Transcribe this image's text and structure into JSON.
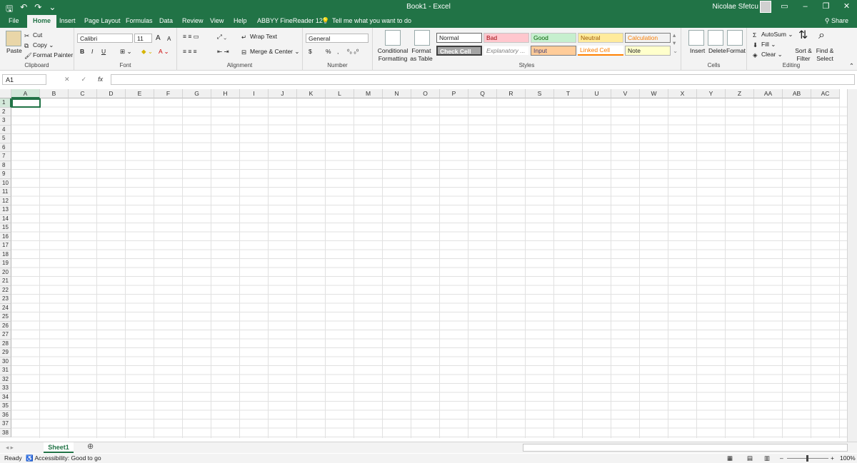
{
  "titlebar": {
    "title": "Book1 - Excel",
    "user": "Nicolae Sfetcu",
    "save_icon": "save-icon",
    "undo_icon": "undo-icon",
    "redo_icon": "redo-icon"
  },
  "tabs": [
    {
      "label": "File"
    },
    {
      "label": "Home"
    },
    {
      "label": "Insert"
    },
    {
      "label": "Page Layout"
    },
    {
      "label": "Formulas"
    },
    {
      "label": "Data"
    },
    {
      "label": "Review"
    },
    {
      "label": "View"
    },
    {
      "label": "Help"
    },
    {
      "label": "ABBYY FineReader 12"
    },
    {
      "label": "Tell me what you want to do"
    }
  ],
  "share_label": "Share",
  "ribbon": {
    "clipboard": {
      "paste": "Paste",
      "cut": "Cut",
      "copy": "Copy",
      "format_painter": "Format Painter",
      "label": "Clipboard"
    },
    "font": {
      "name": "Calibri",
      "size": "11",
      "bold": "B",
      "italic": "I",
      "underline": "U",
      "grow": "A",
      "shrink": "A",
      "label": "Font"
    },
    "alignment": {
      "wrap": "Wrap Text",
      "merge": "Merge & Center",
      "label": "Alignment"
    },
    "number": {
      "format": "General",
      "currency": "$",
      "percent": "%",
      "comma": ",",
      "label": "Number"
    },
    "styles": {
      "conditional": "Conditional Formatting",
      "format_table": "Format as Table",
      "cells": [
        {
          "label": "Normal"
        },
        {
          "label": "Bad"
        },
        {
          "label": "Good"
        },
        {
          "label": "Neutral"
        },
        {
          "label": "Calculation"
        },
        {
          "label": "Check Cell"
        },
        {
          "label": "Explanatory ..."
        },
        {
          "label": "Input"
        },
        {
          "label": "Linked Cell"
        },
        {
          "label": "Note"
        }
      ],
      "label": "Styles"
    },
    "cells": {
      "insert": "Insert",
      "delete": "Delete",
      "format": "Format",
      "label": "Cells"
    },
    "editing": {
      "autosum": "AutoSum",
      "fill": "Fill",
      "clear": "Clear",
      "sort": "Sort & Filter",
      "find": "Find & Select",
      "label": "Editing"
    }
  },
  "formula_bar": {
    "name_box": "A1",
    "fx": "fx",
    "cancel": "✕",
    "enter": "✓",
    "value": ""
  },
  "columns": [
    "A",
    "B",
    "C",
    "D",
    "E",
    "F",
    "G",
    "H",
    "I",
    "J",
    "K",
    "L",
    "M",
    "N",
    "O",
    "P",
    "Q",
    "R",
    "S",
    "T",
    "U",
    "V",
    "W",
    "X",
    "Y",
    "Z",
    "AA",
    "AB",
    "AC"
  ],
  "rows": [
    "1",
    "2",
    "3",
    "4",
    "5",
    "6",
    "7",
    "8",
    "9",
    "10",
    "11",
    "12",
    "13",
    "14",
    "15",
    "16",
    "17",
    "18",
    "19",
    "20",
    "21",
    "22",
    "23",
    "24",
    "25",
    "26",
    "27",
    "28",
    "29",
    "30",
    "31",
    "32",
    "33",
    "34",
    "35",
    "36",
    "37",
    "38"
  ],
  "sheet_tabs": [
    {
      "label": "Sheet1"
    }
  ],
  "status": {
    "ready": "Ready",
    "accessibility": "Accessibility: Good to go",
    "zoom": "100%"
  }
}
